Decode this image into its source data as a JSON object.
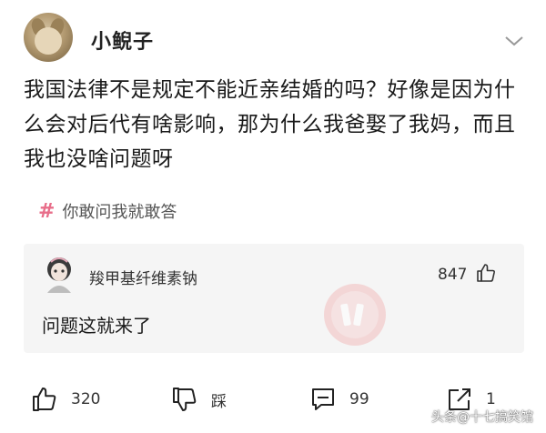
{
  "post": {
    "username": "小鲵子",
    "text": "我国法律不是规定不能近亲结婚的吗？好像是因为什么会对后代有啥影响，那为什么我爸娶了我妈，而且我也没啥问题呀",
    "topic": {
      "hash": "#",
      "label": "你敢问我就敢答"
    }
  },
  "comment": {
    "username": "羧甲基纤维素钠",
    "likes": "847",
    "text": "问题这就来了"
  },
  "actions": {
    "like_count": "320",
    "dislike_label": "踩",
    "comment_count": "99",
    "share_count": "1"
  },
  "watermark": "头条@十七搞笑馆",
  "icons": {
    "chevron": "chevron-down-icon",
    "like": "thumbs-up-icon",
    "dislike": "thumbs-down-icon",
    "comment": "comment-icon",
    "share": "share-icon"
  },
  "colors": {
    "topic_hash": "#e86e8a",
    "comment_bg": "#f5f5f5"
  }
}
